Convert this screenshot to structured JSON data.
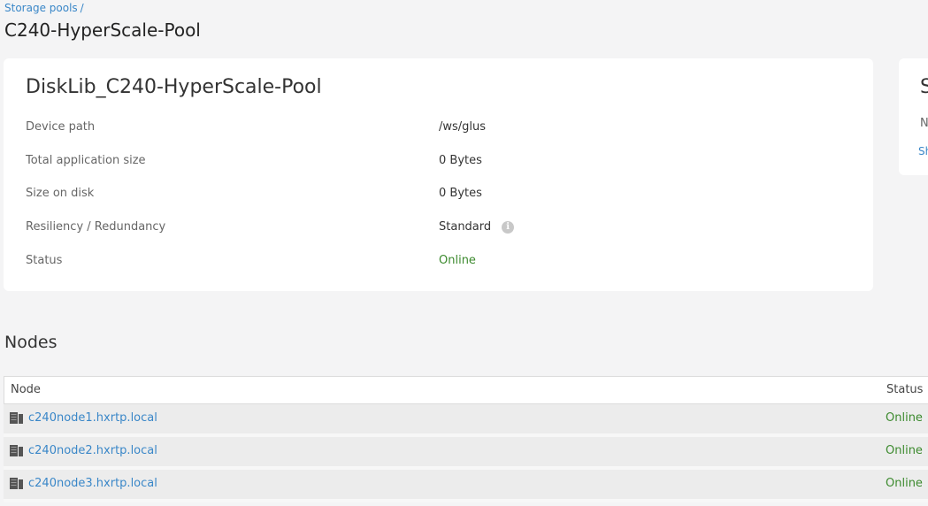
{
  "breadcrumb": {
    "link": "Storage pools",
    "separator": "/"
  },
  "page_title": "C240-HyperScale-Pool",
  "details": {
    "title": "DiskLib_C240-HyperScale-Pool",
    "rows": [
      {
        "label": "Device path",
        "value": "/ws/glus"
      },
      {
        "label": "Total application size",
        "value": "0 Bytes"
      },
      {
        "label": "Size on disk",
        "value": "0 Bytes"
      },
      {
        "label": "Resiliency / Redundancy",
        "value": "Standard",
        "info_icon": "info-icon"
      },
      {
        "label": "Status",
        "value": "Online"
      }
    ]
  },
  "side_panel": {
    "title": "S",
    "line1": "N",
    "link": "Sh"
  },
  "nodes": {
    "section_title": "Nodes",
    "columns": [
      "Node",
      "Status"
    ],
    "rows": [
      {
        "node": "c240node1.hxrtp.local",
        "status": "Online",
        "icon": "server-icon"
      },
      {
        "node": "c240node2.hxrtp.local",
        "status": "Online",
        "icon": "server-icon"
      },
      {
        "node": "c240node3.hxrtp.local",
        "status": "Online",
        "icon": "server-icon"
      }
    ]
  },
  "colors": {
    "link": "#3a87c8",
    "online": "#3c8a2e",
    "background": "#f4f4f5"
  }
}
